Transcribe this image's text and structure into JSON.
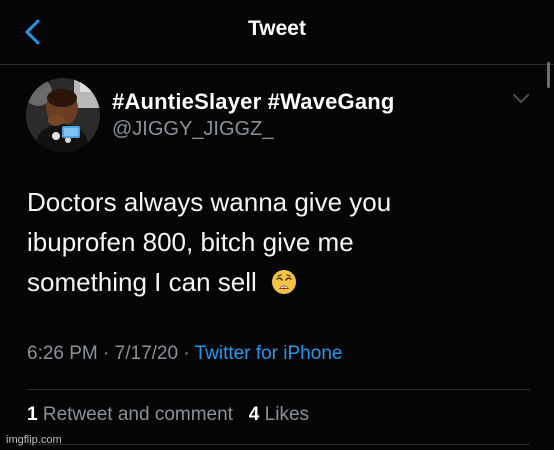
{
  "header": {
    "title": "Tweet",
    "back_icon": "chevron-left-icon",
    "accent": "#1d9bf0"
  },
  "tweet": {
    "display_name": "#AuntieSlayer #WaveGang",
    "handle": "@JIGGY_JIGGZ_",
    "text_lines": [
      "Doctors always wanna give you",
      "ibuprofen 800, bitch give me",
      "something I can sell"
    ],
    "emoji": "weary-face-icon",
    "time": "6:26 PM",
    "date": "7/17/20",
    "separator": "·",
    "source": "Twitter for iPhone",
    "retweet_count": "1",
    "retweet_label": "Retweet and comment",
    "like_count": "4",
    "like_label": "Likes"
  },
  "watermark": "imgflip.com"
}
